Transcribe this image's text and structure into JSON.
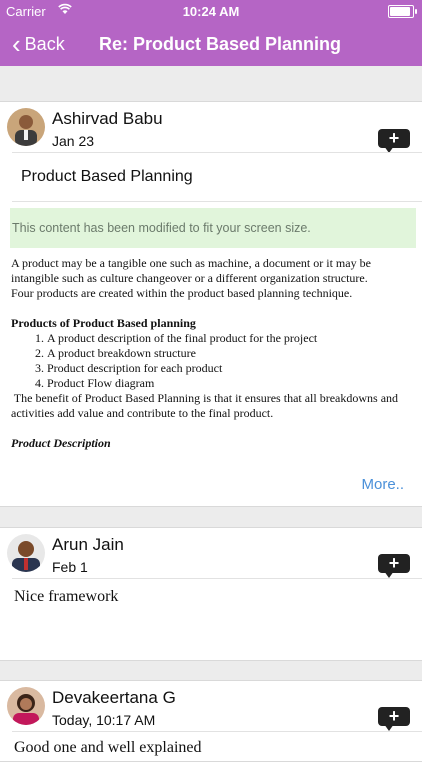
{
  "status_bar": {
    "carrier": "Carrier",
    "time": "10:24 AM"
  },
  "nav": {
    "back_label": "Back",
    "title": "Re: Product Based Planning"
  },
  "posts": [
    {
      "author": "Ashirvad Babu",
      "date": "Jan 23",
      "subject": "Product Based Planning",
      "notice": "This content has been modified to fit your screen size.",
      "intro_lines": [
        "A product may be a tangible one such as machine, a document or it may be",
        "intangible such as culture changeover or a different organization structure.",
        "Four products are created within the product based planning technique."
      ],
      "heading": "Products of Product Based planning",
      "list": [
        "A product description of the final product for the project",
        "A product breakdown structure",
        "Product description for each product",
        "Product Flow diagram"
      ],
      "benefit_lines": [
        " The benefit of Product Based Planning is that it ensures that all breakdowns and",
        "activities add value and contribute to the final product."
      ],
      "subheading": "Product Description",
      "more_label": "More.."
    },
    {
      "author": "Arun Jain",
      "date": "Feb 1",
      "comment": "Nice framework"
    },
    {
      "author": "Devakeertana G",
      "date": "Today, 10:17 AM",
      "comment": "Good one and well explained"
    }
  ],
  "colors": {
    "nav_bar": "#b565c5",
    "notice_bg": "#e1f5db",
    "link": "#4a90d9"
  }
}
